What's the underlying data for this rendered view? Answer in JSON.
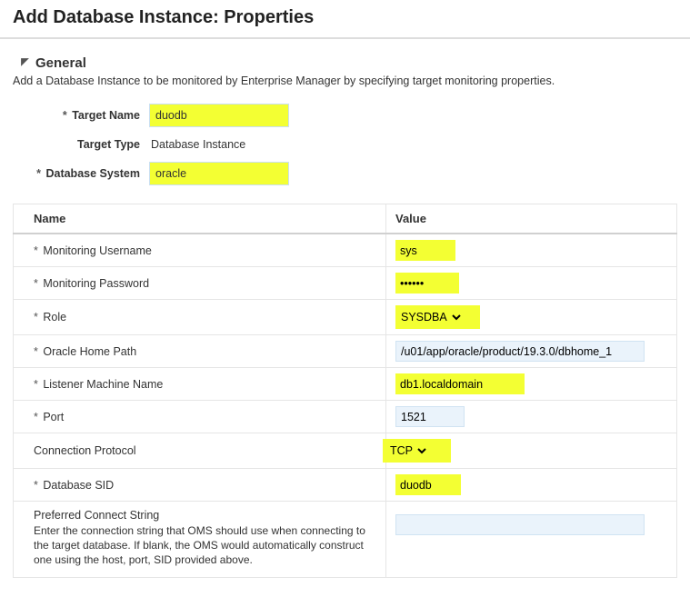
{
  "page": {
    "title": "Add Database Instance: Properties",
    "sectionTitle": "General",
    "intro": "Add a Database Instance to be monitored by Enterprise Manager by specifying target monitoring properties."
  },
  "form": {
    "targetName": {
      "label": "Target Name",
      "value": "duodb"
    },
    "targetType": {
      "label": "Target Type",
      "value": "Database Instance"
    },
    "databaseSystem": {
      "label": "Database System",
      "value": "oracle"
    }
  },
  "tableHeaders": {
    "name": "Name",
    "value": "Value"
  },
  "props": {
    "monUser": {
      "label": "Monitoring Username",
      "req": true,
      "value": "sys"
    },
    "monPass": {
      "label": "Monitoring Password",
      "req": true,
      "value": "••••••"
    },
    "role": {
      "label": "Role",
      "req": true,
      "value": "SYSDBA"
    },
    "ohome": {
      "label": "Oracle Home Path",
      "req": true,
      "value": "/u01/app/oracle/product/19.3.0/dbhome_1"
    },
    "listener": {
      "label": "Listener Machine Name",
      "req": true,
      "value": "db1.localdomain"
    },
    "port": {
      "label": "Port",
      "req": true,
      "value": "1521"
    },
    "protocol": {
      "label": "Connection Protocol",
      "req": false,
      "value": "TCP"
    },
    "sid": {
      "label": "Database SID",
      "req": true,
      "value": "duodb"
    },
    "pcs": {
      "label": "Preferred Connect String",
      "desc": "Enter the connection string that OMS should use when connecting to the target database. If blank, the OMS would automatically construct one using the host, port, SID provided above.",
      "value": ""
    }
  }
}
